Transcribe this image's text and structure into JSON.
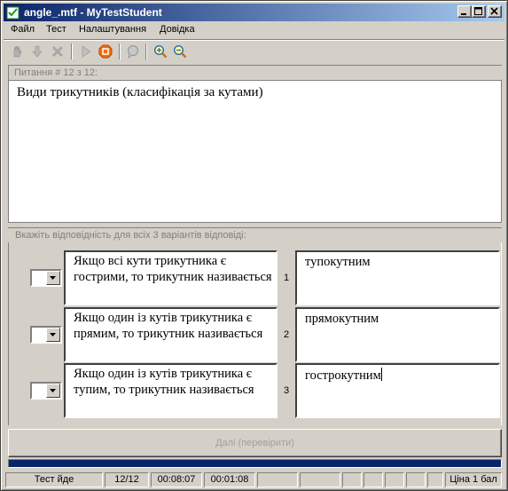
{
  "window": {
    "title": "angle_.mtf - MyTestStudent"
  },
  "menu": {
    "items": [
      "Файл",
      "Тест",
      "Налаштування",
      "Довідка"
    ]
  },
  "toolbar": {
    "buttons": [
      "hand-icon",
      "arrow-down-icon",
      "cross-icon",
      "play-icon",
      "stop-icon",
      "chat-icon",
      "zoom-in-icon",
      "zoom-out-icon"
    ]
  },
  "question": {
    "header": "Питання # 12 з 12:",
    "text": "Види трикутників (класифікація за кутами)"
  },
  "instruction": "Вкажіть відповідність для всіх 3 варіантів відповіді:",
  "answers": {
    "left": [
      "Якщо всі кути трикутника є гострими, то трикутник називається",
      "Якщо один із кутів трикутника є прямим, то трикутник називається",
      "Якщо один із кутів трикутника є тупим, то трикутник називається"
    ],
    "numbers": [
      "1",
      "2",
      "3"
    ],
    "right": [
      "тупокутним",
      "прямокутним",
      "гострокутним"
    ]
  },
  "next_button": "Далі (перевірити)",
  "progress": 1.0,
  "status": {
    "state": "Тест йде",
    "counter": "12/12",
    "elapsed": "00:08:07",
    "question_time": "00:01:08",
    "price": "Ціна 1 бал"
  },
  "colors": {
    "title_start": "#0a246a",
    "title_end": "#a6caf0",
    "progress": "#0a246a"
  }
}
